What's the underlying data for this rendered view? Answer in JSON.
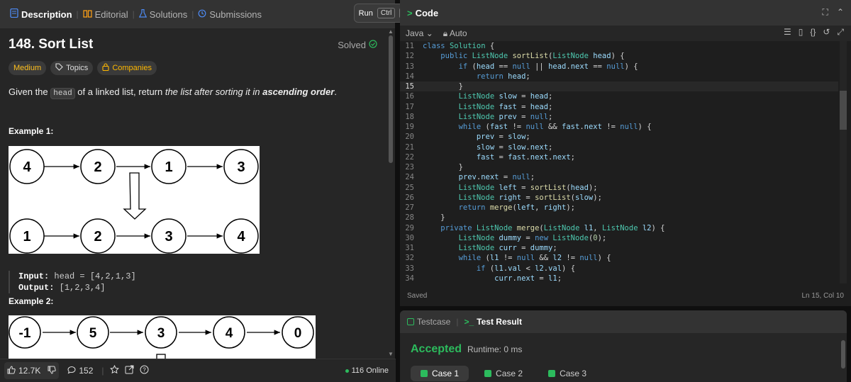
{
  "tabs": {
    "description": "Description",
    "editorial": "Editorial",
    "solutions": "Solutions",
    "submissions": "Submissions"
  },
  "run": {
    "label": "Run",
    "key": "Ctrl",
    "key2": "'"
  },
  "problem": {
    "title": "148. Sort List",
    "solved": "Solved",
    "difficulty": "Medium",
    "topics": "Topics",
    "companies": "Companies",
    "desc_pre": "Given the ",
    "desc_code": "head",
    "desc_mid": " of a linked list, return ",
    "desc_em": "the list after sorting it in ",
    "desc_strong": "ascending order",
    "desc_end": ".",
    "ex1_title": "Example 1:",
    "ex1_in_label": "Input:",
    "ex1_in": "head = [4,2,1,3]",
    "ex1_out_label": "Output:",
    "ex1_out": "[1,2,3,4]",
    "ex2_title": "Example 2:"
  },
  "ex1_image": {
    "row1": [
      "4",
      "2",
      "1",
      "3"
    ],
    "row2": [
      "1",
      "2",
      "3",
      "4"
    ]
  },
  "ex2_image": {
    "row1": [
      "-1",
      "5",
      "3",
      "4",
      "0"
    ]
  },
  "footer": {
    "likes": "12.7K",
    "comments": "152",
    "online": "116 Online"
  },
  "editor": {
    "header": "Code",
    "language": "Java",
    "mode": "Auto",
    "saved": "Saved",
    "cursor": "Ln 15, Col 10",
    "current_line": 15
  },
  "code_lines": [
    {
      "n": "11",
      "t": "class Solution {"
    },
    {
      "n": "12",
      "t": "    public ListNode sortList(ListNode head) {"
    },
    {
      "n": "13",
      "t": "        if (head == null || head.next == null) {"
    },
    {
      "n": "14",
      "t": "            return head;"
    },
    {
      "n": "15",
      "t": "        }"
    },
    {
      "n": "16",
      "t": "        ListNode slow = head;"
    },
    {
      "n": "17",
      "t": "        ListNode fast = head;"
    },
    {
      "n": "18",
      "t": "        ListNode prev = null;"
    },
    {
      "n": "19",
      "t": "        while (fast != null && fast.next != null) {"
    },
    {
      "n": "20",
      "t": "            prev = slow;"
    },
    {
      "n": "21",
      "t": "            slow = slow.next;"
    },
    {
      "n": "22",
      "t": "            fast = fast.next.next;"
    },
    {
      "n": "23",
      "t": "        }"
    },
    {
      "n": "24",
      "t": "        prev.next = null;"
    },
    {
      "n": "25",
      "t": "        ListNode left = sortList(head);"
    },
    {
      "n": "26",
      "t": "        ListNode right = sortList(slow);"
    },
    {
      "n": "27",
      "t": "        return merge(left, right);"
    },
    {
      "n": "28",
      "t": "    }"
    },
    {
      "n": "29",
      "t": "    private ListNode merge(ListNode l1, ListNode l2) {"
    },
    {
      "n": "30",
      "t": "        ListNode dummy = new ListNode(0);"
    },
    {
      "n": "31",
      "t": "        ListNode curr = dummy;"
    },
    {
      "n": "32",
      "t": "        while (l1 != null && l2 != null) {"
    },
    {
      "n": "33",
      "t": "            if (l1.val < l2.val) {"
    },
    {
      "n": "34",
      "t": "                curr.next = l1;"
    }
  ],
  "results": {
    "testcase": "Testcase",
    "test_result": "Test Result",
    "status": "Accepted",
    "runtime": "Runtime: 0 ms",
    "cases": [
      "Case 1",
      "Case 2",
      "Case 3"
    ]
  },
  "colors": {
    "accent": "#2cbb5d",
    "medium": "#ffc01e"
  }
}
